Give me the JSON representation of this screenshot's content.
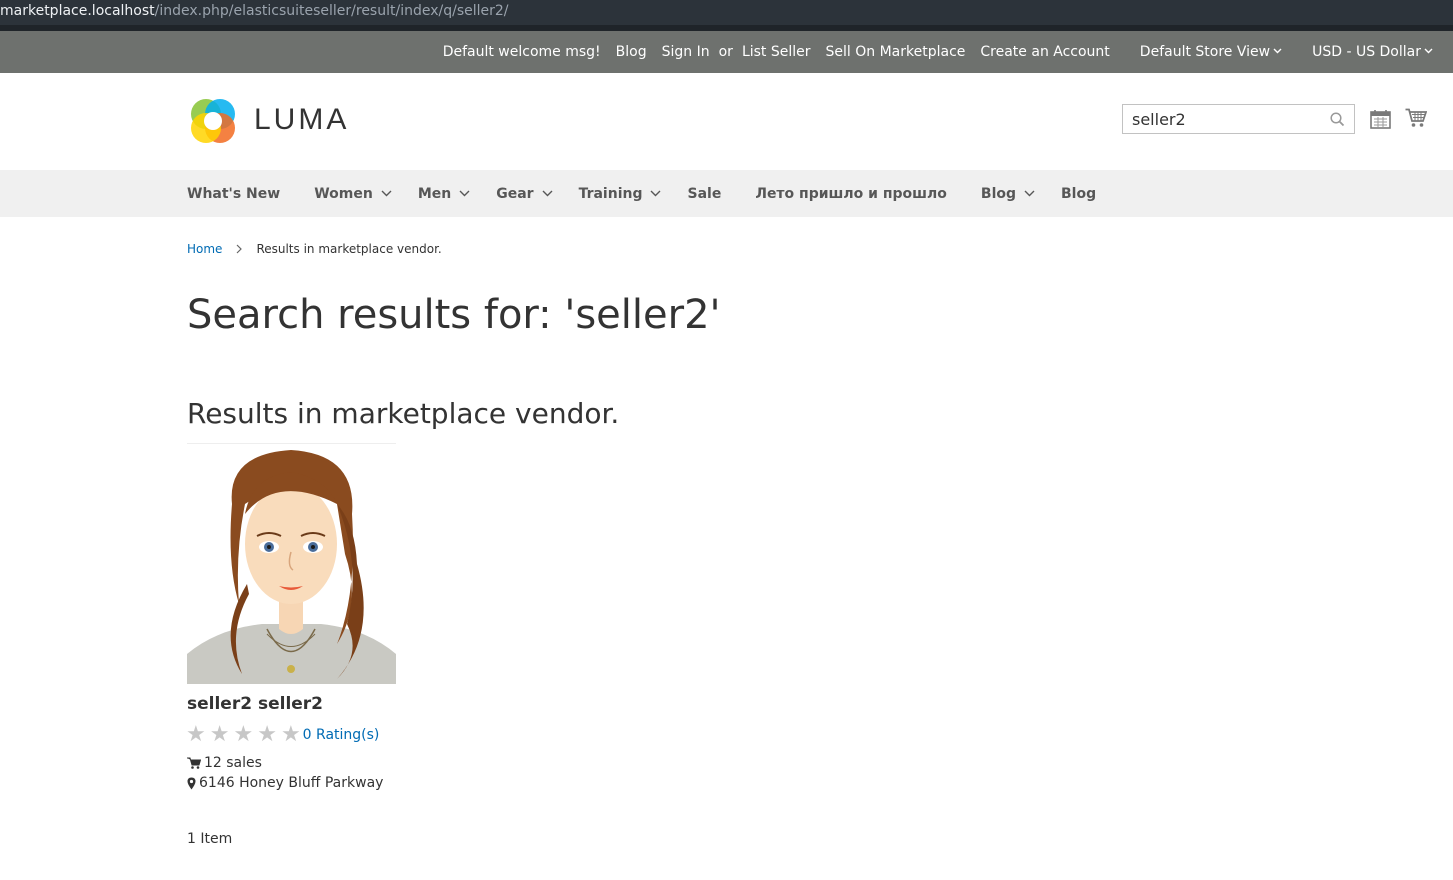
{
  "browser": {
    "url_host": "marketplace.localhost",
    "url_path": "/index.php/elasticsuiteseller/result/index/q/seller2/"
  },
  "panel": {
    "welcome": "Default welcome msg!",
    "blog": "Blog",
    "sign_in": "Sign In",
    "or": "or",
    "list_seller": "List Seller",
    "sell_on_marketplace": "Sell On Marketplace",
    "create_account": "Create an Account",
    "store_view": "Default Store View",
    "currency": "USD - US Dollar"
  },
  "header": {
    "logo_text": "LUMA",
    "search_value": "seller2",
    "icons": [
      "search-icon",
      "compare-icon",
      "cart-icon"
    ]
  },
  "nav": {
    "items": [
      {
        "label": "What's New",
        "dropdown": false
      },
      {
        "label": "Women",
        "dropdown": true
      },
      {
        "label": "Men",
        "dropdown": true
      },
      {
        "label": "Gear",
        "dropdown": true
      },
      {
        "label": "Training",
        "dropdown": true
      },
      {
        "label": "Sale",
        "dropdown": false
      },
      {
        "label": "Лето пришло и прошло",
        "dropdown": false
      },
      {
        "label": "Blog",
        "dropdown": true
      },
      {
        "label": "Blog",
        "dropdown": false
      }
    ]
  },
  "breadcrumbs": {
    "home": "Home",
    "current": "Results in marketplace vendor."
  },
  "page": {
    "title": "Search results for: 'seller2'",
    "section_title": "Results in marketplace vendor."
  },
  "vendor": {
    "name": "seller2 seller2",
    "rating_stars": 0,
    "rating_max": 5,
    "rating_link": "0 Rating(s)",
    "sales": "12 sales",
    "address": "6146 Honey Bluff Parkway"
  },
  "toolbar": {
    "amount": "1 Item"
  },
  "colors": {
    "link": "#006bb4",
    "panel_bg": "#6e716e",
    "nav_bg": "#f0f0f0",
    "star_empty": "#c7c7c7"
  }
}
